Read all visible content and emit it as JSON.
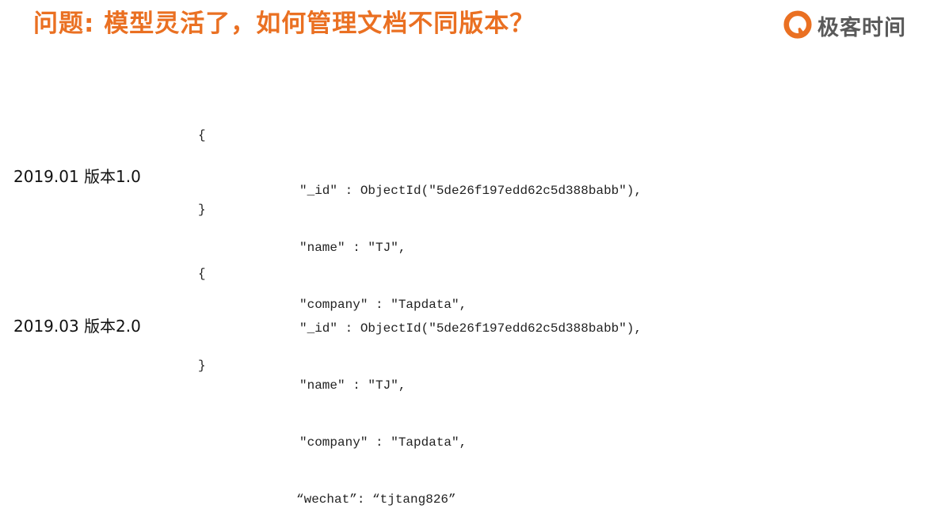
{
  "title": "问题: 模型灵活了，如何管理文档不同版本？",
  "logo": {
    "text": "极客时间",
    "icon": "geektime-logo-icon",
    "color": "#ea7022"
  },
  "versions": [
    {
      "label": "2019.01 版本1.0",
      "open": "{",
      "lines": [
        "\"_id\" : ObjectId(\"5de26f197edd62c5d388babb\"),",
        "\"name\" : \"TJ\",",
        "\"company\" : \"Tapdata\","
      ],
      "close": "}"
    },
    {
      "label": "2019.03 版本2.0",
      "open": "{",
      "lines": [
        "\"_id\" : ObjectId(\"5de26f197edd62c5d388babb\"),",
        "\"name\" : \"TJ\",",
        "\"company\" : \"Tapdata\",",
        "“wechat”: “tjtang826”"
      ],
      "close": "}"
    }
  ],
  "colors": {
    "title": "#ea7022",
    "text": "#222222"
  }
}
